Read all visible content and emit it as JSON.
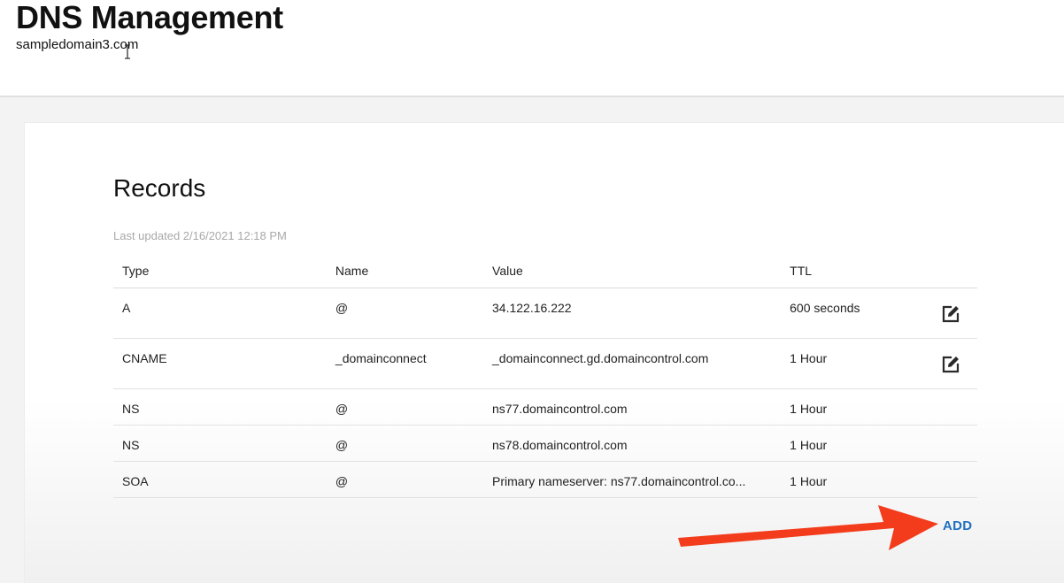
{
  "header": {
    "title": "DNS Management",
    "domain": "sampledomain3.com"
  },
  "records": {
    "title": "Records",
    "last_updated": "Last updated 2/16/2021 12:18 PM",
    "columns": [
      "Type",
      "Name",
      "Value",
      "TTL"
    ],
    "rows": [
      {
        "type": "A",
        "name": "@",
        "value": "34.122.16.222",
        "ttl": "600 seconds",
        "editable": true
      },
      {
        "type": "CNAME",
        "name": "_domainconnect",
        "value": "_domainconnect.gd.domaincontrol.com",
        "ttl": "1 Hour",
        "editable": true
      },
      {
        "type": "NS",
        "name": "@",
        "value": "ns77.domaincontrol.com",
        "ttl": "1 Hour",
        "editable": false
      },
      {
        "type": "NS",
        "name": "@",
        "value": "ns78.domaincontrol.com",
        "ttl": "1 Hour",
        "editable": false
      },
      {
        "type": "SOA",
        "name": "@",
        "value": "Primary nameserver: ns77.domaincontrol.co...",
        "ttl": "1 Hour",
        "editable": false
      }
    ],
    "add_label": "ADD"
  },
  "icons": {
    "edit": "edit-icon",
    "text_cursor": "i-beam-cursor-icon",
    "annotation": "red-arrow-annotation"
  },
  "colors": {
    "accent": "#1f6fc0",
    "annotation_arrow": "#f33c1c",
    "muted_text": "#a8a8a8"
  }
}
